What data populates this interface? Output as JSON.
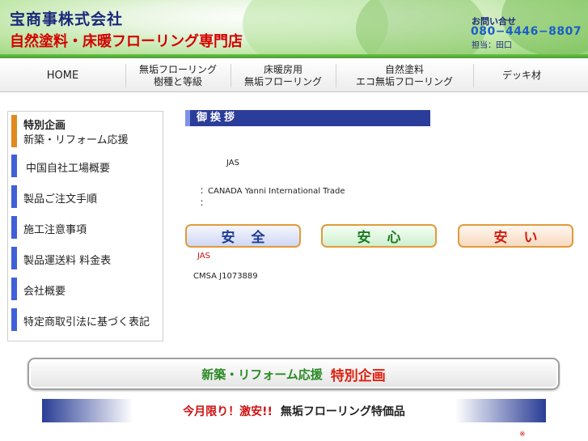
{
  "header": {
    "company": "宝商事株式会社",
    "tagline": "自然塗料・床暖フローリング専門店",
    "contact_label": "お問い合せ",
    "contact_phone": "080−4446−8807",
    "contact_person": "担当：田口"
  },
  "nav": {
    "items": [
      {
        "line1": "HOME",
        "line2": ""
      },
      {
        "line1": "無垢フローリング",
        "line2": "樹種と等級"
      },
      {
        "line1": "床暖房用",
        "line2": "無垢フローリング"
      },
      {
        "line1": "自然塗料",
        "line2": "エコ無垢フローリング"
      },
      {
        "line1": "デッキ材",
        "line2": ""
      }
    ]
  },
  "sidebar": {
    "items": [
      {
        "line1": "特別企画",
        "line2": "新築・リフォーム応援",
        "bar_color": "#e08a1e"
      },
      {
        "line1": "中国自社工場概要",
        "line2": "",
        "bar_color": "#4060d8"
      },
      {
        "line1": "製品ご注文手順",
        "line2": "",
        "bar_color": "#4060d8"
      },
      {
        "line1": "施工注意事項",
        "line2": "",
        "bar_color": "#4060d8"
      },
      {
        "line1": "製品運送料 料金表",
        "line2": "",
        "bar_color": "#4060d8"
      },
      {
        "line1": "会社概要",
        "line2": "",
        "bar_color": "#4060d8"
      },
      {
        "line1": "特定商取引法に基づく表記",
        "line2": "",
        "bar_color": "#4060d8"
      }
    ]
  },
  "main": {
    "greeting_title": "御挨拶",
    "text_jas": "JAS",
    "text_canada": "：CANADA Yanni International Trade",
    "text_colon": "：",
    "pills": [
      "安全",
      "安心",
      "安い"
    ],
    "text_jas_red": "JAS",
    "text_cmsa": "CMSA J1073889"
  },
  "banners": {
    "banner1_a": "新築・リフォーム応援",
    "banner1_b": "特別企画",
    "banner2_a": "今月限り！激安!!",
    "banner2_b": "無垢フローリング特価品",
    "mark": "※"
  }
}
